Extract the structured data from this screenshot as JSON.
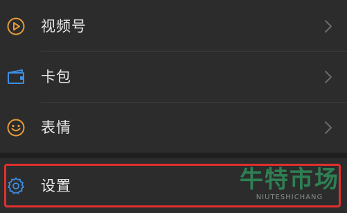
{
  "menu": {
    "items": [
      {
        "label": "视频号",
        "icon": "video-channel-icon",
        "icon_color": "#e59a3a"
      },
      {
        "label": "卡包",
        "icon": "card-wallet-icon",
        "icon_color": "#3d8fe6"
      },
      {
        "label": "表情",
        "icon": "emoji-smile-icon",
        "icon_color": "#e59a3a"
      }
    ],
    "settings": {
      "label": "设置",
      "icon": "settings-gear-icon",
      "icon_color": "#3d8fe6"
    }
  },
  "watermark": {
    "title": "牛特市场",
    "subtitle": "NIUTESHICHANG"
  },
  "colors": {
    "background": "#1f1f1f",
    "row_background": "#2c2c2c",
    "text": "#e8e8e8",
    "chevron": "#6b6b6b",
    "highlight_border": "#e0302f",
    "watermark_green": "#2f8f5a"
  }
}
